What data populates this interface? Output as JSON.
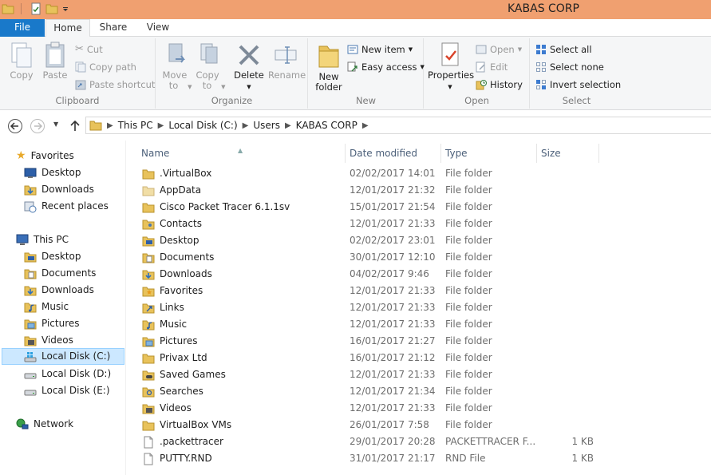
{
  "window": {
    "title": "KABAS CORP"
  },
  "tabs": {
    "file": "File",
    "home": "Home",
    "share": "Share",
    "view": "View"
  },
  "ribbon": {
    "clipboard": {
      "label": "Clipboard",
      "copy": "Copy",
      "paste": "Paste",
      "cut": "Cut",
      "copy_path": "Copy path",
      "paste_shortcut": "Paste shortcut"
    },
    "organize": {
      "label": "Organize",
      "move_to": "Move to",
      "copy_to": "Copy to",
      "delete": "Delete",
      "rename": "Rename"
    },
    "new": {
      "label": "New",
      "new_folder": "New folder",
      "new_item": "New item",
      "easy_access": "Easy access"
    },
    "open": {
      "label": "Open",
      "properties": "Properties",
      "open": "Open",
      "edit": "Edit",
      "history": "History"
    },
    "select": {
      "label": "Select",
      "select_all": "Select all",
      "select_none": "Select none",
      "invert_selection": "Invert selection"
    }
  },
  "address": {
    "crumbs": [
      "This PC",
      "Local Disk (C:)",
      "Users",
      "KABAS CORP"
    ]
  },
  "nav": {
    "favorites": "Favorites",
    "fav_items": [
      "Desktop",
      "Downloads",
      "Recent places"
    ],
    "this_pc": "This PC",
    "pc_items": [
      "Desktop",
      "Documents",
      "Downloads",
      "Music",
      "Pictures",
      "Videos",
      "Local Disk (C:)",
      "Local Disk (D:)",
      "Local Disk (E:)"
    ],
    "network": "Network"
  },
  "columns": {
    "name": "Name",
    "date": "Date modified",
    "type": "Type",
    "size": "Size"
  },
  "files": [
    {
      "name": ".VirtualBox",
      "date": "02/02/2017 14:01",
      "type": "File folder",
      "size": "",
      "icon": "folder-icon"
    },
    {
      "name": "AppData",
      "date": "12/01/2017 21:32",
      "type": "File folder",
      "size": "",
      "icon": "folder-hidden-icon"
    },
    {
      "name": "Cisco Packet Tracer 6.1.1sv",
      "date": "15/01/2017 21:54",
      "type": "File folder",
      "size": "",
      "icon": "folder-icon"
    },
    {
      "name": "Contacts",
      "date": "12/01/2017 21:33",
      "type": "File folder",
      "size": "",
      "icon": "contacts-folder-icon"
    },
    {
      "name": "Desktop",
      "date": "02/02/2017 23:01",
      "type": "File folder",
      "size": "",
      "icon": "desktop-folder-icon"
    },
    {
      "name": "Documents",
      "date": "30/01/2017 12:10",
      "type": "File folder",
      "size": "",
      "icon": "documents-folder-icon"
    },
    {
      "name": "Downloads",
      "date": "04/02/2017 9:46",
      "type": "File folder",
      "size": "",
      "icon": "downloads-folder-icon"
    },
    {
      "name": "Favorites",
      "date": "12/01/2017 21:33",
      "type": "File folder",
      "size": "",
      "icon": "favorites-folder-icon"
    },
    {
      "name": "Links",
      "date": "12/01/2017 21:33",
      "type": "File folder",
      "size": "",
      "icon": "links-folder-icon"
    },
    {
      "name": "Music",
      "date": "12/01/2017 21:33",
      "type": "File folder",
      "size": "",
      "icon": "music-folder-icon"
    },
    {
      "name": "Pictures",
      "date": "16/01/2017 21:27",
      "type": "File folder",
      "size": "",
      "icon": "pictures-folder-icon"
    },
    {
      "name": "Privax Ltd",
      "date": "16/01/2017 21:12",
      "type": "File folder",
      "size": "",
      "icon": "folder-icon"
    },
    {
      "name": "Saved Games",
      "date": "12/01/2017 21:33",
      "type": "File folder",
      "size": "",
      "icon": "saved-games-folder-icon"
    },
    {
      "name": "Searches",
      "date": "12/01/2017 21:34",
      "type": "File folder",
      "size": "",
      "icon": "searches-folder-icon"
    },
    {
      "name": "Videos",
      "date": "12/01/2017 21:33",
      "type": "File folder",
      "size": "",
      "icon": "videos-folder-icon"
    },
    {
      "name": "VirtualBox VMs",
      "date": "26/01/2017 7:58",
      "type": "File folder",
      "size": "",
      "icon": "folder-icon"
    },
    {
      "name": ".packettracer",
      "date": "29/01/2017 20:28",
      "type": "PACKETTRACER F...",
      "size": "1 KB",
      "icon": "file-icon"
    },
    {
      "name": "PUTTY.RND",
      "date": "31/01/2017 21:17",
      "type": "RND File",
      "size": "1 KB",
      "icon": "file-icon"
    }
  ],
  "colors": {
    "title_bar": "#f0a070",
    "file_tab": "#1979ca",
    "selection": "#cce8ff",
    "folder": "#e8c25b"
  }
}
